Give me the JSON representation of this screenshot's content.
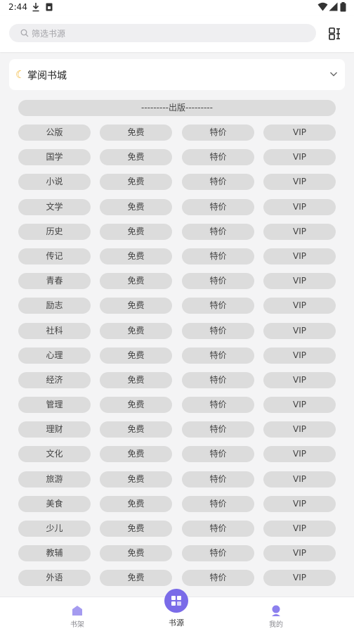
{
  "status_bar": {
    "time": "2:44"
  },
  "search": {
    "placeholder": "筛选书源"
  },
  "source_card": {
    "title": "掌阅书城"
  },
  "section": {
    "label": "---------出版---------"
  },
  "rows": [
    [
      "公版",
      "免费",
      "特价",
      "VIP"
    ],
    [
      "国学",
      "免费",
      "特价",
      "VIP"
    ],
    [
      "小说",
      "免费",
      "特价",
      "VIP"
    ],
    [
      "文学",
      "免费",
      "特价",
      "VIP"
    ],
    [
      "历史",
      "免费",
      "特价",
      "VIP"
    ],
    [
      "传记",
      "免费",
      "特价",
      "VIP"
    ],
    [
      "青春",
      "免费",
      "特价",
      "VIP"
    ],
    [
      "励志",
      "免费",
      "特价",
      "VIP"
    ],
    [
      "社科",
      "免费",
      "特价",
      "VIP"
    ],
    [
      "心理",
      "免费",
      "特价",
      "VIP"
    ],
    [
      "经济",
      "免费",
      "特价",
      "VIP"
    ],
    [
      "管理",
      "免费",
      "特价",
      "VIP"
    ],
    [
      "理财",
      "免费",
      "特价",
      "VIP"
    ],
    [
      "文化",
      "免费",
      "特价",
      "VIP"
    ],
    [
      "旅游",
      "免费",
      "特价",
      "VIP"
    ],
    [
      "美食",
      "免费",
      "特价",
      "VIP"
    ],
    [
      "少儿",
      "免费",
      "特价",
      "VIP"
    ],
    [
      "教辅",
      "免费",
      "特价",
      "VIP"
    ],
    [
      "外语",
      "免费",
      "特价",
      "VIP"
    ]
  ],
  "bottom_nav": {
    "bookshelf": "书架",
    "sources": "书源",
    "mine": "我的"
  },
  "colors": {
    "accent": "#7a6be8",
    "chip_bg": "#dcdcdc",
    "page_bg": "#f4f4f5"
  },
  "icons": {
    "download": "download-icon",
    "sim": "sim-card-icon",
    "wifi": "wifi-icon",
    "signal": "signal-icon",
    "battery": "battery-icon",
    "search": "search-icon",
    "scan": "scan-icon",
    "moon": "moon-icon",
    "chevron": "chevron-down-icon",
    "bookshelf": "bookshelf-icon",
    "sources": "grid-icon",
    "mine": "person-icon"
  }
}
